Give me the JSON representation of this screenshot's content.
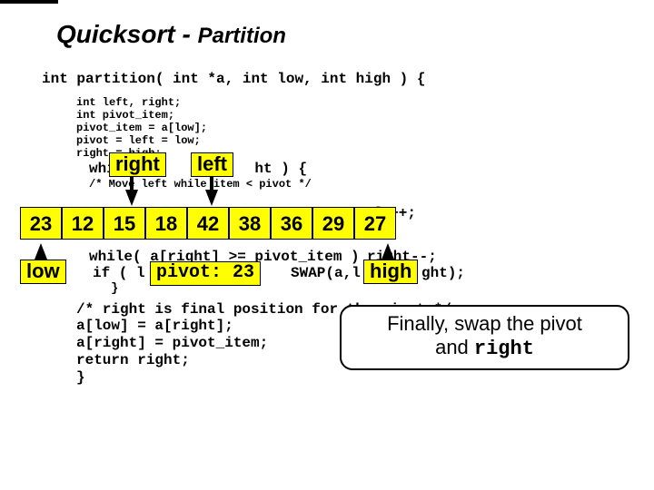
{
  "title_main": "Quicksort - ",
  "title_sub": "Partition",
  "code": {
    "signature": "int partition( int *a, int low, int high ) {",
    "decl": "int left, right;\nint pivot_item;\npivot_item = a[low];\npivot = left = low;\nright = high;",
    "while_open": "while (            ht ) {",
    "comment_move": "/* Move left while item < pivot */",
    "move_left_tail": "ft++;",
    "move_right": "while( a[right] >= pivot_item )",
    "move_right_tail": "right--;",
    "swap_a": "if ( l",
    "swap_b": "SWAP(a,l       ght);",
    "r_brace": "}",
    "comment_final": "/* right is final position for the pivot */",
    "rest": "a[low] = a[right];\na[right] = pivot_item;\nreturn right;\n}"
  },
  "labels": {
    "right": "right",
    "left": "left",
    "low": "low",
    "high": "high",
    "pivot": "pivot: 23"
  },
  "array": [
    "23",
    "12",
    "15",
    "18",
    "42",
    "38",
    "36",
    "29",
    "27"
  ],
  "callout": {
    "line1": "Finally, swap the pivot",
    "line2a": "and ",
    "line2b": "right"
  }
}
